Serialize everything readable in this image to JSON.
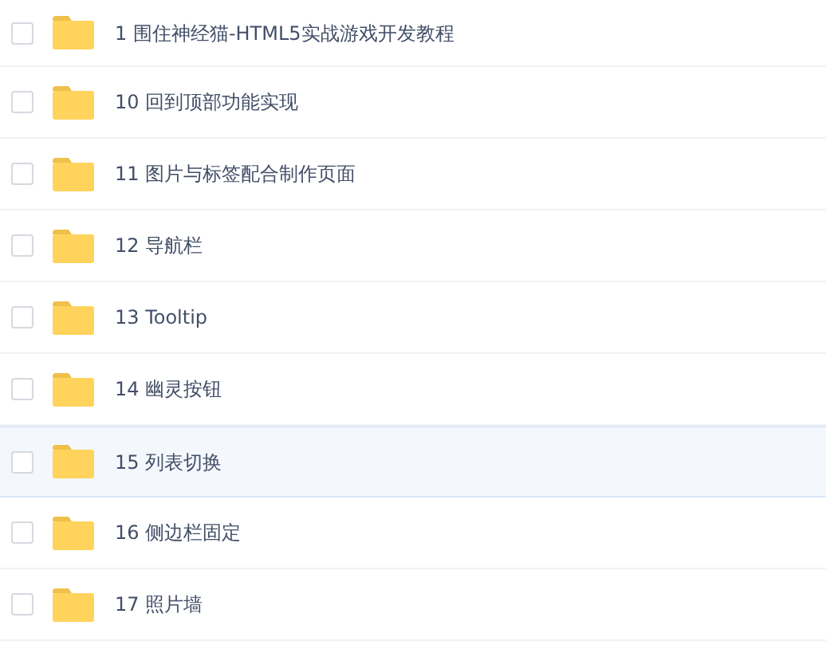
{
  "files": [
    {
      "name": "1 围住神经猫-HTML5实战游戏开发教程",
      "checked": false,
      "highlighted": false
    },
    {
      "name": "10 回到顶部功能实现",
      "checked": false,
      "highlighted": false
    },
    {
      "name": "11 图片与标签配合制作页面",
      "checked": false,
      "highlighted": false
    },
    {
      "name": "12 导航栏",
      "checked": false,
      "highlighted": false
    },
    {
      "name": "13 Tooltip",
      "checked": false,
      "highlighted": false
    },
    {
      "name": "14 幽灵按钮",
      "checked": false,
      "highlighted": false
    },
    {
      "name": "15 列表切换",
      "checked": false,
      "highlighted": true
    },
    {
      "name": "16 侧边栏固定",
      "checked": false,
      "highlighted": false
    },
    {
      "name": "17 照片墙",
      "checked": false,
      "highlighted": false
    }
  ]
}
